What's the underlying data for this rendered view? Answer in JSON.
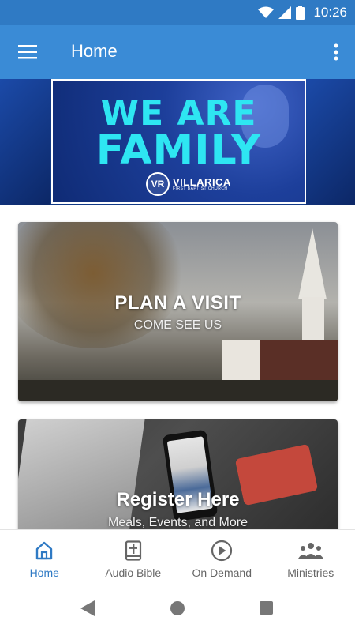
{
  "status_bar": {
    "time": "10:26",
    "icons": [
      "wifi-icon",
      "signal-icon",
      "battery-icon"
    ]
  },
  "app_bar": {
    "title": "Home",
    "menu_icon": "hamburger-menu-icon",
    "more_icon": "more-vertical-icon"
  },
  "banner": {
    "line1": "WE ARE",
    "line2": "FAMILY",
    "logo_mark": "VR",
    "logo_name": "VILLARICA",
    "logo_sub": "FIRST BAPTIST CHURCH"
  },
  "cards": [
    {
      "title": "PLAN A VISIT",
      "subtitle": "COME SEE US"
    },
    {
      "title": "Register Here",
      "subtitle": "Meals, Events, and More"
    }
  ],
  "bottom_nav": {
    "items": [
      {
        "label": "Home",
        "icon": "home-icon",
        "active": true
      },
      {
        "label": "Audio Bible",
        "icon": "bible-icon",
        "active": false
      },
      {
        "label": "On Demand",
        "icon": "play-circle-icon",
        "active": false
      },
      {
        "label": "Ministries",
        "icon": "group-icon",
        "active": false
      }
    ]
  },
  "colors": {
    "app_bar": "#3a8bd6",
    "status_bar": "#2f7ac4",
    "active_nav": "#2f7ac4",
    "banner_text": "#2ee6f2"
  }
}
